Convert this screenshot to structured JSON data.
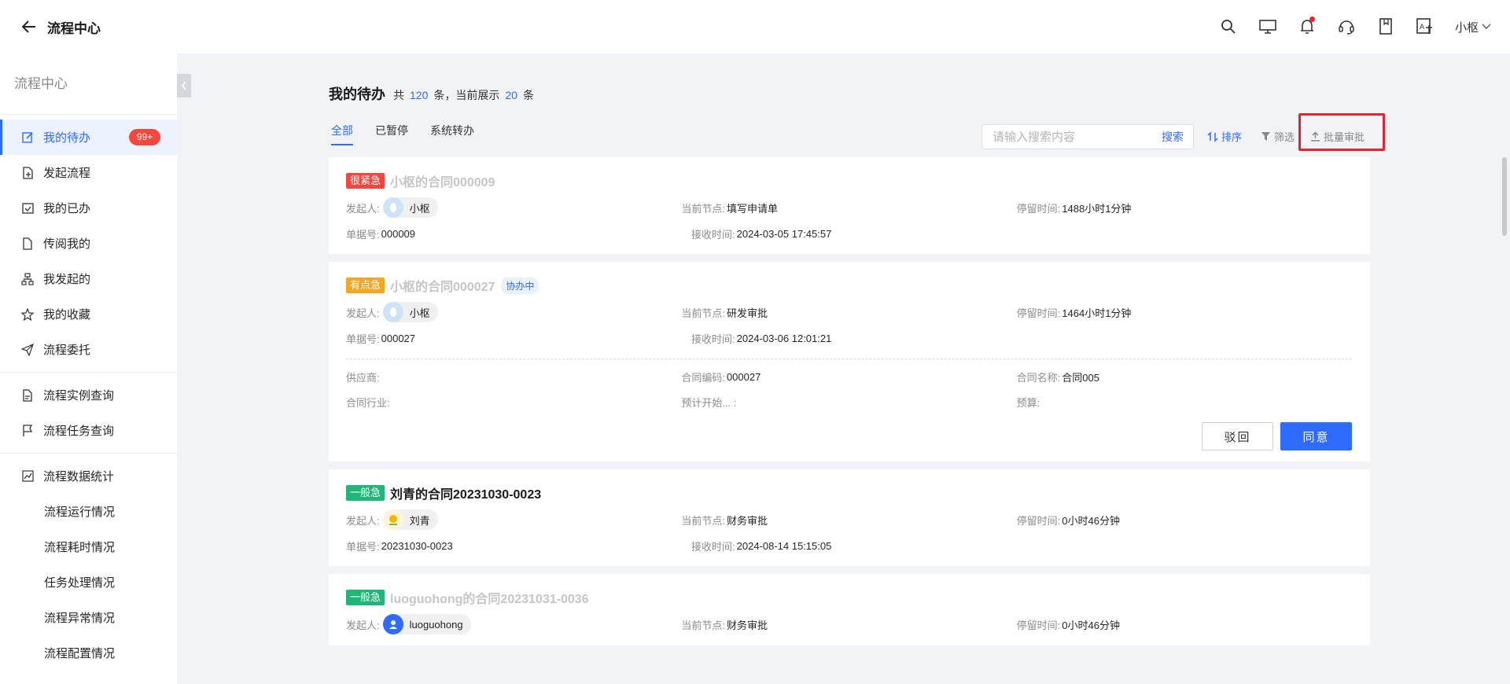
{
  "app": {
    "title": "流程中心"
  },
  "topbar": {
    "user_name": "小枢",
    "icons": [
      "search-icon",
      "monitor-icon",
      "bell-icon",
      "headset-icon",
      "book-icon",
      "translate-icon"
    ]
  },
  "sidebar": {
    "header": "流程中心",
    "items": [
      {
        "label": "我的待办",
        "icon": "edit-icon",
        "badge": "99+",
        "active": true
      },
      {
        "label": "发起流程",
        "icon": "file-add-icon"
      },
      {
        "label": "我的已办",
        "icon": "calendar-check-icon"
      },
      {
        "label": "传阅我的",
        "icon": "file-icon"
      },
      {
        "label": "我发起的",
        "icon": "hierarchy-icon"
      },
      {
        "label": "我的收藏",
        "icon": "star-icon"
      },
      {
        "label": "流程委托",
        "icon": "send-icon"
      },
      {
        "label": "流程实例查询",
        "icon": "doc-search-icon"
      },
      {
        "label": "流程任务查询",
        "icon": "flag-icon"
      },
      {
        "label": "流程数据统计",
        "icon": "chart-icon"
      },
      {
        "label": "流程运行情况"
      },
      {
        "label": "流程耗时情况"
      },
      {
        "label": "任务处理情况"
      },
      {
        "label": "流程异常情况"
      },
      {
        "label": "流程配置情况"
      }
    ]
  },
  "main": {
    "title": "我的待办",
    "count": {
      "prefix": "共",
      "total": "120",
      "mid": "条，当前展示",
      "shown": "20",
      "suffix": "条"
    },
    "tabs": [
      {
        "label": "全部",
        "active": true
      },
      {
        "label": "已暂停"
      },
      {
        "label": "系统转办"
      }
    ],
    "search": {
      "placeholder": "请输入搜索内容",
      "button": "搜索"
    },
    "tools": {
      "sort": "排序",
      "filter": "筛选",
      "batch": "批量审批"
    },
    "labels": {
      "initiator": "发起人:",
      "node": "当前节点:",
      "stay": "停留时间:",
      "number": "单据号:",
      "received": "接收时间:"
    },
    "cards": [
      {
        "priority": "很紧急",
        "title": "小枢的合同000009",
        "initiator": "小枢",
        "node": "填写申请单",
        "stay": "1488小时1分钟",
        "number": "000009",
        "received": "2024-03-05 17:45:57"
      },
      {
        "priority": "有点急",
        "title": "小枢的合同000027",
        "tag": "协办中",
        "initiator": "小枢",
        "node": "研发审批",
        "stay": "1464小时1分钟",
        "number": "000027",
        "received": "2024-03-06 12:01:21",
        "extra": {
          "supplier_label": "供应商:",
          "contract_code_label": "合同编码:",
          "contract_code": "000027",
          "contract_name_label": "合同名称:",
          "contract_name": "合同005",
          "industry_label": "合同行业:",
          "start_label": "预计开始... :",
          "budget_label": "预算:"
        },
        "actions": {
          "reject": "驳回",
          "agree": "同意"
        }
      },
      {
        "priority": "一般急",
        "title": "刘青的合同20231030-0023",
        "initiator": "刘青",
        "node": "财务审批",
        "stay": "0小时46分钟",
        "number": "20231030-0023",
        "received": "2024-08-14 15:15:05"
      },
      {
        "priority": "一般急",
        "title": "luoguohong的合同20231031-0036",
        "initiator": "luoguohong",
        "node": "财务审批",
        "stay": "0小时46分钟"
      }
    ]
  },
  "colors": {
    "accent": "#2f6bff",
    "urgent": "#f5473e",
    "medium": "#f5a623",
    "normal": "#1fb678",
    "highlight": "#e8222d"
  }
}
